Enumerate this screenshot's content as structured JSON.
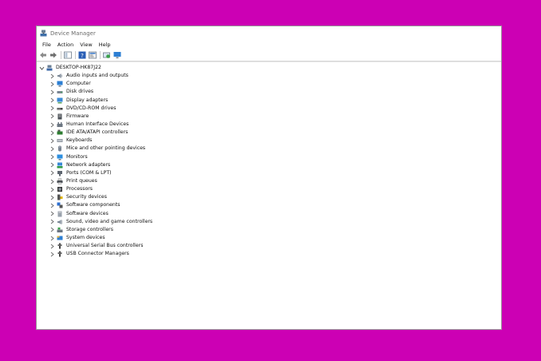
{
  "window": {
    "title": "Device Manager"
  },
  "menu": [
    "File",
    "Action",
    "View",
    "Help"
  ],
  "toolbar": [
    {
      "name": "back-button-icon",
      "glyph": "back"
    },
    {
      "name": "forward-button-icon",
      "glyph": "forward"
    },
    {
      "name": "show-hide-console-tree-icon",
      "glyph": "grid"
    },
    {
      "name": "help-icon",
      "glyph": "help"
    },
    {
      "name": "properties-icon",
      "glyph": "panel"
    },
    {
      "name": "scan-hardware-icon",
      "glyph": "scan"
    },
    {
      "name": "monitor-icon",
      "glyph": "monitor"
    }
  ],
  "tree": {
    "root": "DESKTOP-HK87J22",
    "categories": [
      {
        "label": "Audio inputs and outputs",
        "icon": "speaker-icon"
      },
      {
        "label": "Computer",
        "icon": "computer-icon"
      },
      {
        "label": "Disk drives",
        "icon": "disk-drive-icon"
      },
      {
        "label": "Display adapters",
        "icon": "display-adapter-icon"
      },
      {
        "label": "DVD/CD-ROM drives",
        "icon": "dvd-drive-icon"
      },
      {
        "label": "Firmware",
        "icon": "firmware-icon"
      },
      {
        "label": "Human Interface Devices",
        "icon": "hid-icon"
      },
      {
        "label": "IDE ATA/ATAPI controllers",
        "icon": "ide-controller-icon"
      },
      {
        "label": "Keyboards",
        "icon": "keyboard-icon"
      },
      {
        "label": "Mice and other pointing devices",
        "icon": "mouse-icon"
      },
      {
        "label": "Monitors",
        "icon": "monitor-icon"
      },
      {
        "label": "Network adapters",
        "icon": "network-adapter-icon"
      },
      {
        "label": "Ports (COM & LPT)",
        "icon": "port-icon"
      },
      {
        "label": "Print queues",
        "icon": "printer-icon"
      },
      {
        "label": "Processors",
        "icon": "processor-icon"
      },
      {
        "label": "Security devices",
        "icon": "security-device-icon"
      },
      {
        "label": "Software components",
        "icon": "software-component-icon"
      },
      {
        "label": "Software devices",
        "icon": "software-device-icon"
      },
      {
        "label": "Sound, video and game controllers",
        "icon": "sound-controller-icon"
      },
      {
        "label": "Storage controllers",
        "icon": "storage-controller-icon"
      },
      {
        "label": "System devices",
        "icon": "system-device-icon"
      },
      {
        "label": "Universal Serial Bus controllers",
        "icon": "usb-icon"
      },
      {
        "label": "USB Connector Managers",
        "icon": "usb-icon"
      }
    ]
  },
  "colors": {
    "background": "#cc00b4",
    "window": "#ffffff",
    "accent": "#1e78d2"
  }
}
